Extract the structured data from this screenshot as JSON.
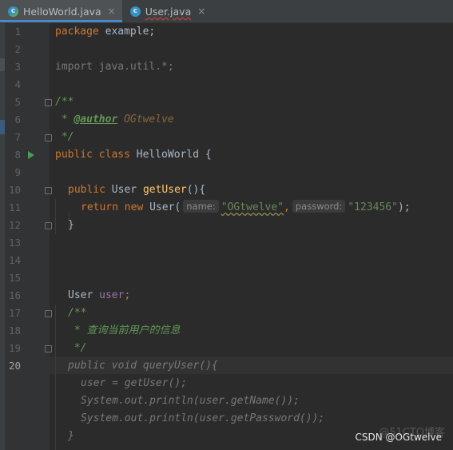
{
  "tabs": [
    {
      "label": "HelloWorld.java",
      "icon": "java-class-icon",
      "close": "×",
      "active": true
    },
    {
      "label": "User.java",
      "icon": "java-class-icon",
      "close": "×",
      "active": false
    }
  ],
  "line_numbers": [
    "1",
    "2",
    "3",
    "4",
    "5",
    "6",
    "7",
    "8",
    "9",
    "10",
    "11",
    "12",
    "13",
    "14",
    "15",
    "16",
    "17",
    "18",
    "19",
    "20"
  ],
  "code": {
    "l1_kw": "package",
    "l1_rest": " example;",
    "l3": "import java.util.*;",
    "l5": "/**",
    "l6_star": " * ",
    "l6_tag": "@author",
    "l6_val": " OGtwelve",
    "l7": " */",
    "l8_kw": "public class",
    "l8_rest": " HelloWorld {",
    "l10_kw": "public",
    "l10_type": " User ",
    "l10_fn": "getUser",
    "l10_rest": "(){",
    "l11_kw": "return new",
    "l11_type": " User(",
    "l11_hint1": "name:",
    "l11_str1": "\"OGtwelve\"",
    "l11_comma": ",",
    "l11_hint2": "password:",
    "l11_str2": "\"123456\"",
    "l11_end": ");",
    "l12": "}",
    "l16_type": "User ",
    "l16_var": "user",
    "l16_semi": ";",
    "l17": "/**",
    "l18": " * 查询当前用户的信息",
    "l19": " */",
    "l20_a": "public void ",
    "l20_b": "queryUser",
    "l20_c": "(){",
    "l21": "user = getUser();",
    "l22": "System.out.println(user.getName());",
    "l23": "System.out.println(user.getPassword());",
    "l24": "}"
  },
  "watermark": "CSDN @OGtwelve",
  "watermark_faint": "@51CTO博客",
  "current_line": "20"
}
